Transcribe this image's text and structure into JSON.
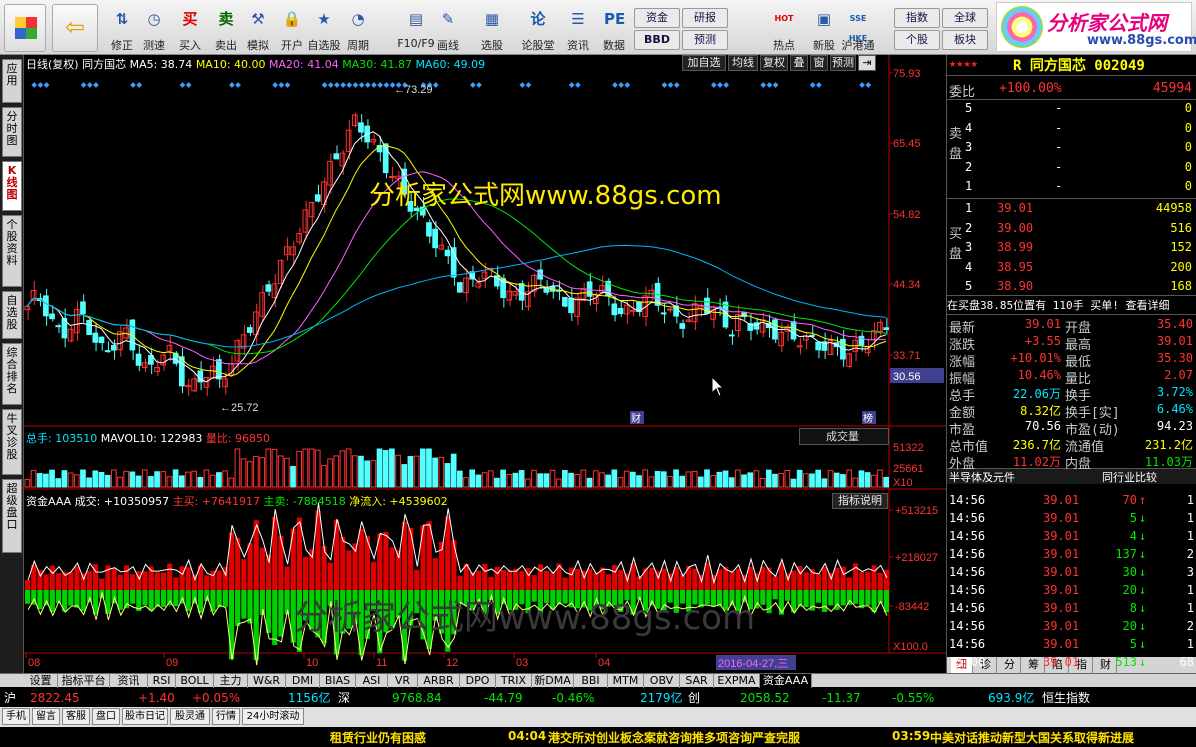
{
  "toolbar": {
    "items": [
      {
        "label": "",
        "icon": "app-grid-icon"
      },
      {
        "label": "",
        "icon": "back-arrow-icon"
      },
      {
        "label": "修正",
        "icon": "up-down-icon"
      },
      {
        "label": "测速",
        "icon": "clock-icon"
      },
      {
        "label": "买入",
        "icon": "buy-icon",
        "glyph": "买"
      },
      {
        "label": "卖出",
        "icon": "sell-icon",
        "glyph": "卖"
      },
      {
        "label": "模拟",
        "icon": "hammer-icon"
      },
      {
        "label": "开户",
        "icon": "lock-icon"
      },
      {
        "label": "自选股",
        "icon": "star-icon"
      },
      {
        "label": "周期",
        "icon": "period-icon"
      },
      {
        "label": "F10/F9",
        "icon": "f10-icon"
      },
      {
        "label": "画线",
        "icon": "pencil-icon"
      },
      {
        "label": "选股",
        "icon": "picker-icon"
      },
      {
        "label": "论股堂",
        "icon": "forum-icon",
        "glyph": "论"
      },
      {
        "label": "资讯",
        "icon": "news-icon"
      },
      {
        "label": "数据",
        "icon": "pe-icon",
        "glyph": "PE"
      },
      {
        "label": "热点",
        "icon": "hot-icon",
        "glyph": "HOT"
      },
      {
        "label": "新股",
        "icon": "ipo-icon"
      },
      {
        "label": "沪港通",
        "icon": "sse-hkex-icon",
        "glyph": "SSE HKE"
      }
    ],
    "small": [
      "资金",
      "研报",
      "BBD",
      "预测",
      "指数",
      "全球",
      "个股",
      "板块"
    ],
    "logo_text": "分析家公式网",
    "logo_url": "www.88gs.com"
  },
  "left_tabs": [
    "应用",
    "分时图",
    "K线图",
    "个股资料",
    "自选股",
    "综合排名",
    "牛叉诊股",
    "超级盘口"
  ],
  "kline": {
    "header": {
      "period": "日线(复权)",
      "name": "同方国芯",
      "ma5": "MA5: 38.74",
      "ma10": "MA10: 40.00",
      "ma20": "MA20: 41.04",
      "ma30": "MA30: 41.87",
      "ma60": "MA60: 49.09"
    },
    "buttons": [
      "加自选",
      "均线",
      "复权",
      "叠",
      "窗",
      "预测"
    ],
    "yticks": [
      "75.93",
      "65.45",
      "54.82",
      "44.34",
      "33.71"
    ],
    "current": "30.56",
    "high_label": "73.29",
    "low_label": "25.72",
    "watermark": "分析家公式网www.88gs.com",
    "mark_cai": "财",
    "mark_bang": "榜"
  },
  "volume": {
    "header": {
      "total": "总手: 103510",
      "mavol": "MAVOL10: 122983",
      "ratio": "量比: 96850"
    },
    "select": "成交量",
    "yticks": [
      "51322",
      "25661"
    ],
    "unit": "X10"
  },
  "fund": {
    "header": {
      "name": "资金AAA",
      "turnover": "成交: +10350957",
      "buy": "主买: +7641917",
      "sell": "主卖: -7884518",
      "net": "净流入: +4539602"
    },
    "btn": "指标说明",
    "yticks": [
      "+513215",
      "+218027",
      "-83442"
    ],
    "unit": "X100.0",
    "watermark": "分析家公式网www.88gs.com"
  },
  "xaxis": {
    "months": [
      "08",
      "09",
      "10",
      "11",
      "12",
      "03",
      "04"
    ],
    "cursor_date": "2016-04-27,三"
  },
  "stock": {
    "stars": "★★★★",
    "code_name": "R 同方国芯 002049",
    "weibi_label": "委比",
    "weibi": "+100.00%",
    "weicha": "45994",
    "sell_label": "卖盘",
    "sells": [
      {
        "n": "5",
        "p": "-",
        "v": "0"
      },
      {
        "n": "4",
        "p": "-",
        "v": "0"
      },
      {
        "n": "3",
        "p": "-",
        "v": "0"
      },
      {
        "n": "2",
        "p": "-",
        "v": "0"
      },
      {
        "n": "1",
        "p": "-",
        "v": "0"
      }
    ],
    "buy_label": "买盘",
    "buys": [
      {
        "n": "1",
        "p": "39.01",
        "v": "44958"
      },
      {
        "n": "2",
        "p": "39.00",
        "v": "516"
      },
      {
        "n": "3",
        "p": "38.99",
        "v": "152"
      },
      {
        "n": "4",
        "p": "38.95",
        "v": "200"
      },
      {
        "n": "5",
        "p": "38.90",
        "v": "168"
      }
    ],
    "info_line": "在买盘38.85位置有 110手 买单! 查看详细",
    "stats": [
      {
        "l1": "最新",
        "v1": "39.01",
        "l2": "开盘",
        "v2": "35.40"
      },
      {
        "l1": "涨跌",
        "v1": "+3.55",
        "l2": "最高",
        "v2": "39.01"
      },
      {
        "l1": "涨幅",
        "v1": "+10.01%",
        "l2": "最低",
        "v2": "35.30"
      },
      {
        "l1": "振幅",
        "v1": "10.46%",
        "l2": "量比",
        "v2": "2.07"
      },
      {
        "l1": "总手",
        "v1": "22.06万",
        "l2": "换手",
        "v2": "3.72%"
      },
      {
        "l1": "金额",
        "v1": "8.32亿",
        "l2": "换手[实]",
        "v2": "6.46%"
      },
      {
        "l1": "市盈",
        "v1": "70.56",
        "l2": "市盈(动)",
        "v2": "94.23"
      },
      {
        "l1": "总市值",
        "v1": "236.7亿",
        "l2": "流通值",
        "v2": "231.2亿"
      },
      {
        "l1": "外盘",
        "v1": "11.02万",
        "l2": "内盘",
        "v2": "11.03万"
      }
    ],
    "industry": "半导体及元件",
    "compare": "同行业比较",
    "ticks": [
      {
        "t": "14:56",
        "p": "39.01",
        "v": "70",
        "d": "up",
        "n": "1"
      },
      {
        "t": "14:56",
        "p": "39.01",
        "v": "5",
        "d": "down",
        "n": "1"
      },
      {
        "t": "14:56",
        "p": "39.01",
        "v": "4",
        "d": "down",
        "n": "1"
      },
      {
        "t": "14:56",
        "p": "39.01",
        "v": "137",
        "d": "down",
        "n": "2"
      },
      {
        "t": "14:56",
        "p": "39.01",
        "v": "30",
        "d": "down",
        "n": "3"
      },
      {
        "t": "14:56",
        "p": "39.01",
        "v": "20",
        "d": "down",
        "n": "1"
      },
      {
        "t": "14:56",
        "p": "39.01",
        "v": "8",
        "d": "down",
        "n": "1"
      },
      {
        "t": "14:56",
        "p": "39.01",
        "v": "20",
        "d": "down",
        "n": "2"
      },
      {
        "t": "14:56",
        "p": "39.01",
        "v": "5",
        "d": "down",
        "n": "1"
      },
      {
        "t": "15:00",
        "p": "39.01",
        "v": "513",
        "d": "down",
        "n": "68"
      }
    ],
    "right_tabs": [
      "细",
      "诊",
      "分",
      "筹",
      "陷",
      "指",
      "财"
    ]
  },
  "bottom_tabs": [
    "设置",
    "指标平台",
    "资讯",
    "RSI",
    "BOLL",
    "主力",
    "W&R",
    "DMI",
    "BIAS",
    "ASI",
    "VR",
    "ARBR",
    "DPO",
    "TRIX",
    "新DMA",
    "BBI",
    "MTM",
    "OBV",
    "SAR",
    "EXPMA",
    "资金AAA"
  ],
  "index_bar": {
    "sh_label": "沪",
    "sh": "2822.45",
    "sh_chg": "+1.40",
    "sh_pct": "+0.05%",
    "sh_amt": "1156亿",
    "sz_label": "深",
    "sz": "9768.84",
    "sz_chg": "-44.79",
    "sz_pct": "-0.46%",
    "sz_amt": "2179亿",
    "cy_label": "创",
    "cy": "2058.52",
    "cy_chg": "-11.37",
    "cy_pct": "-0.55%",
    "hk_amt": "693.9亿",
    "hk_label": "恒生指数"
  },
  "menu_bar": {
    "items": [
      "手机",
      "留言",
      "客服",
      "盘口",
      "股市日记",
      "股灵通",
      "行情",
      "24小时滚动"
    ],
    "news1": "租赁行业仍有困惑",
    "news2_time": "04:04",
    "news2": "港交所对创业板念案就咨询推多项咨询严查完服",
    "news3_time": "03:59",
    "news3": "中美对话推动新型大国关系取得新进展"
  }
}
